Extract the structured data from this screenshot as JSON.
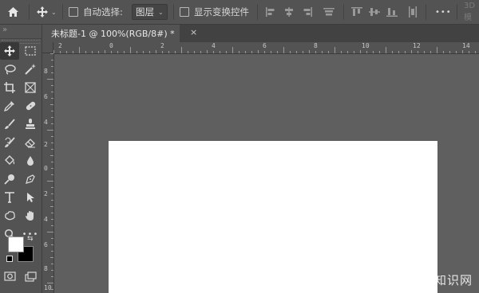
{
  "options_bar": {
    "auto_select_label": "自动选择:",
    "auto_select_target": "图层",
    "show_transform_label": "显示变换控件",
    "more": "•••",
    "mode_3d": "3D 模"
  },
  "document_tab": {
    "title": "未标题-1 @ 100%(RGB/8#) *",
    "close": "×"
  },
  "ruler": {
    "h_labels": [
      "2",
      "0",
      "2",
      "4",
      "6",
      "8",
      "10",
      "12",
      "14"
    ],
    "v_labels": [
      "8",
      "6",
      "4",
      "2",
      "0",
      "2",
      "4",
      "6",
      "8",
      "10"
    ]
  },
  "toolbar": {
    "expand_glyph": "»",
    "tool_names": [
      "move",
      "marquee",
      "lasso",
      "magic-wand",
      "crop",
      "frame",
      "eyedropper",
      "healing",
      "brush",
      "stamp",
      "history-brush",
      "eraser",
      "paint-bucket",
      "blur",
      "dodge",
      "pen",
      "type",
      "path-select",
      "shape",
      "hand",
      "zoom",
      "more"
    ]
  },
  "colors": {
    "foreground": "#ffffff",
    "background": "#000000",
    "workspace": "#5f5f5f",
    "panel": "#535353"
  },
  "watermark": "爱创根知识网"
}
